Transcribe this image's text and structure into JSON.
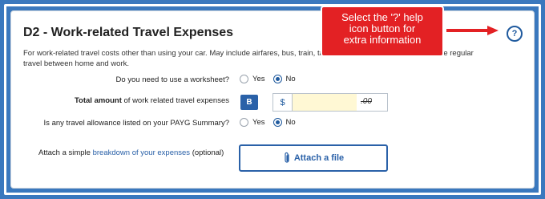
{
  "section": {
    "title": "D2 - Work-related Travel Expenses",
    "description_part1": "For work-related travel costs other than using your car. May include airfares, bus, train, taxi,",
    "description_part2": "not include regular",
    "description_part3": "travel between home and work."
  },
  "help_button": {
    "label": "?"
  },
  "worksheet_question": {
    "label": "Do you need to use a worksheet?",
    "options": [
      "Yes",
      "No"
    ],
    "selected": "No"
  },
  "total_amount": {
    "label_bold": "Total amount",
    "label_rest": " of work related travel expenses",
    "badge": "B",
    "currency": "$",
    "value": ".00"
  },
  "allowance_question": {
    "label": "Is any travel allowance listed on your PAYG Summary?",
    "options": [
      "Yes",
      "No"
    ],
    "selected": "No"
  },
  "attach": {
    "label_prefix": "Attach a simple ",
    "link_text": "breakdown of your expenses",
    "label_suffix": " (optional)",
    "button_label": "Attach a file"
  },
  "callout": {
    "line1": "Select the '?' help",
    "line2": "icon button for",
    "line3": "extra information"
  },
  "colors": {
    "frame_bg": "#3a78be",
    "accent": "#2a61a8",
    "callout_bg": "#e32124",
    "amount_bg": "#fff8d4"
  },
  "icons": {
    "help": "question-mark-circle-icon",
    "attach": "paperclip-icon",
    "arrow": "right-arrow-icon"
  }
}
